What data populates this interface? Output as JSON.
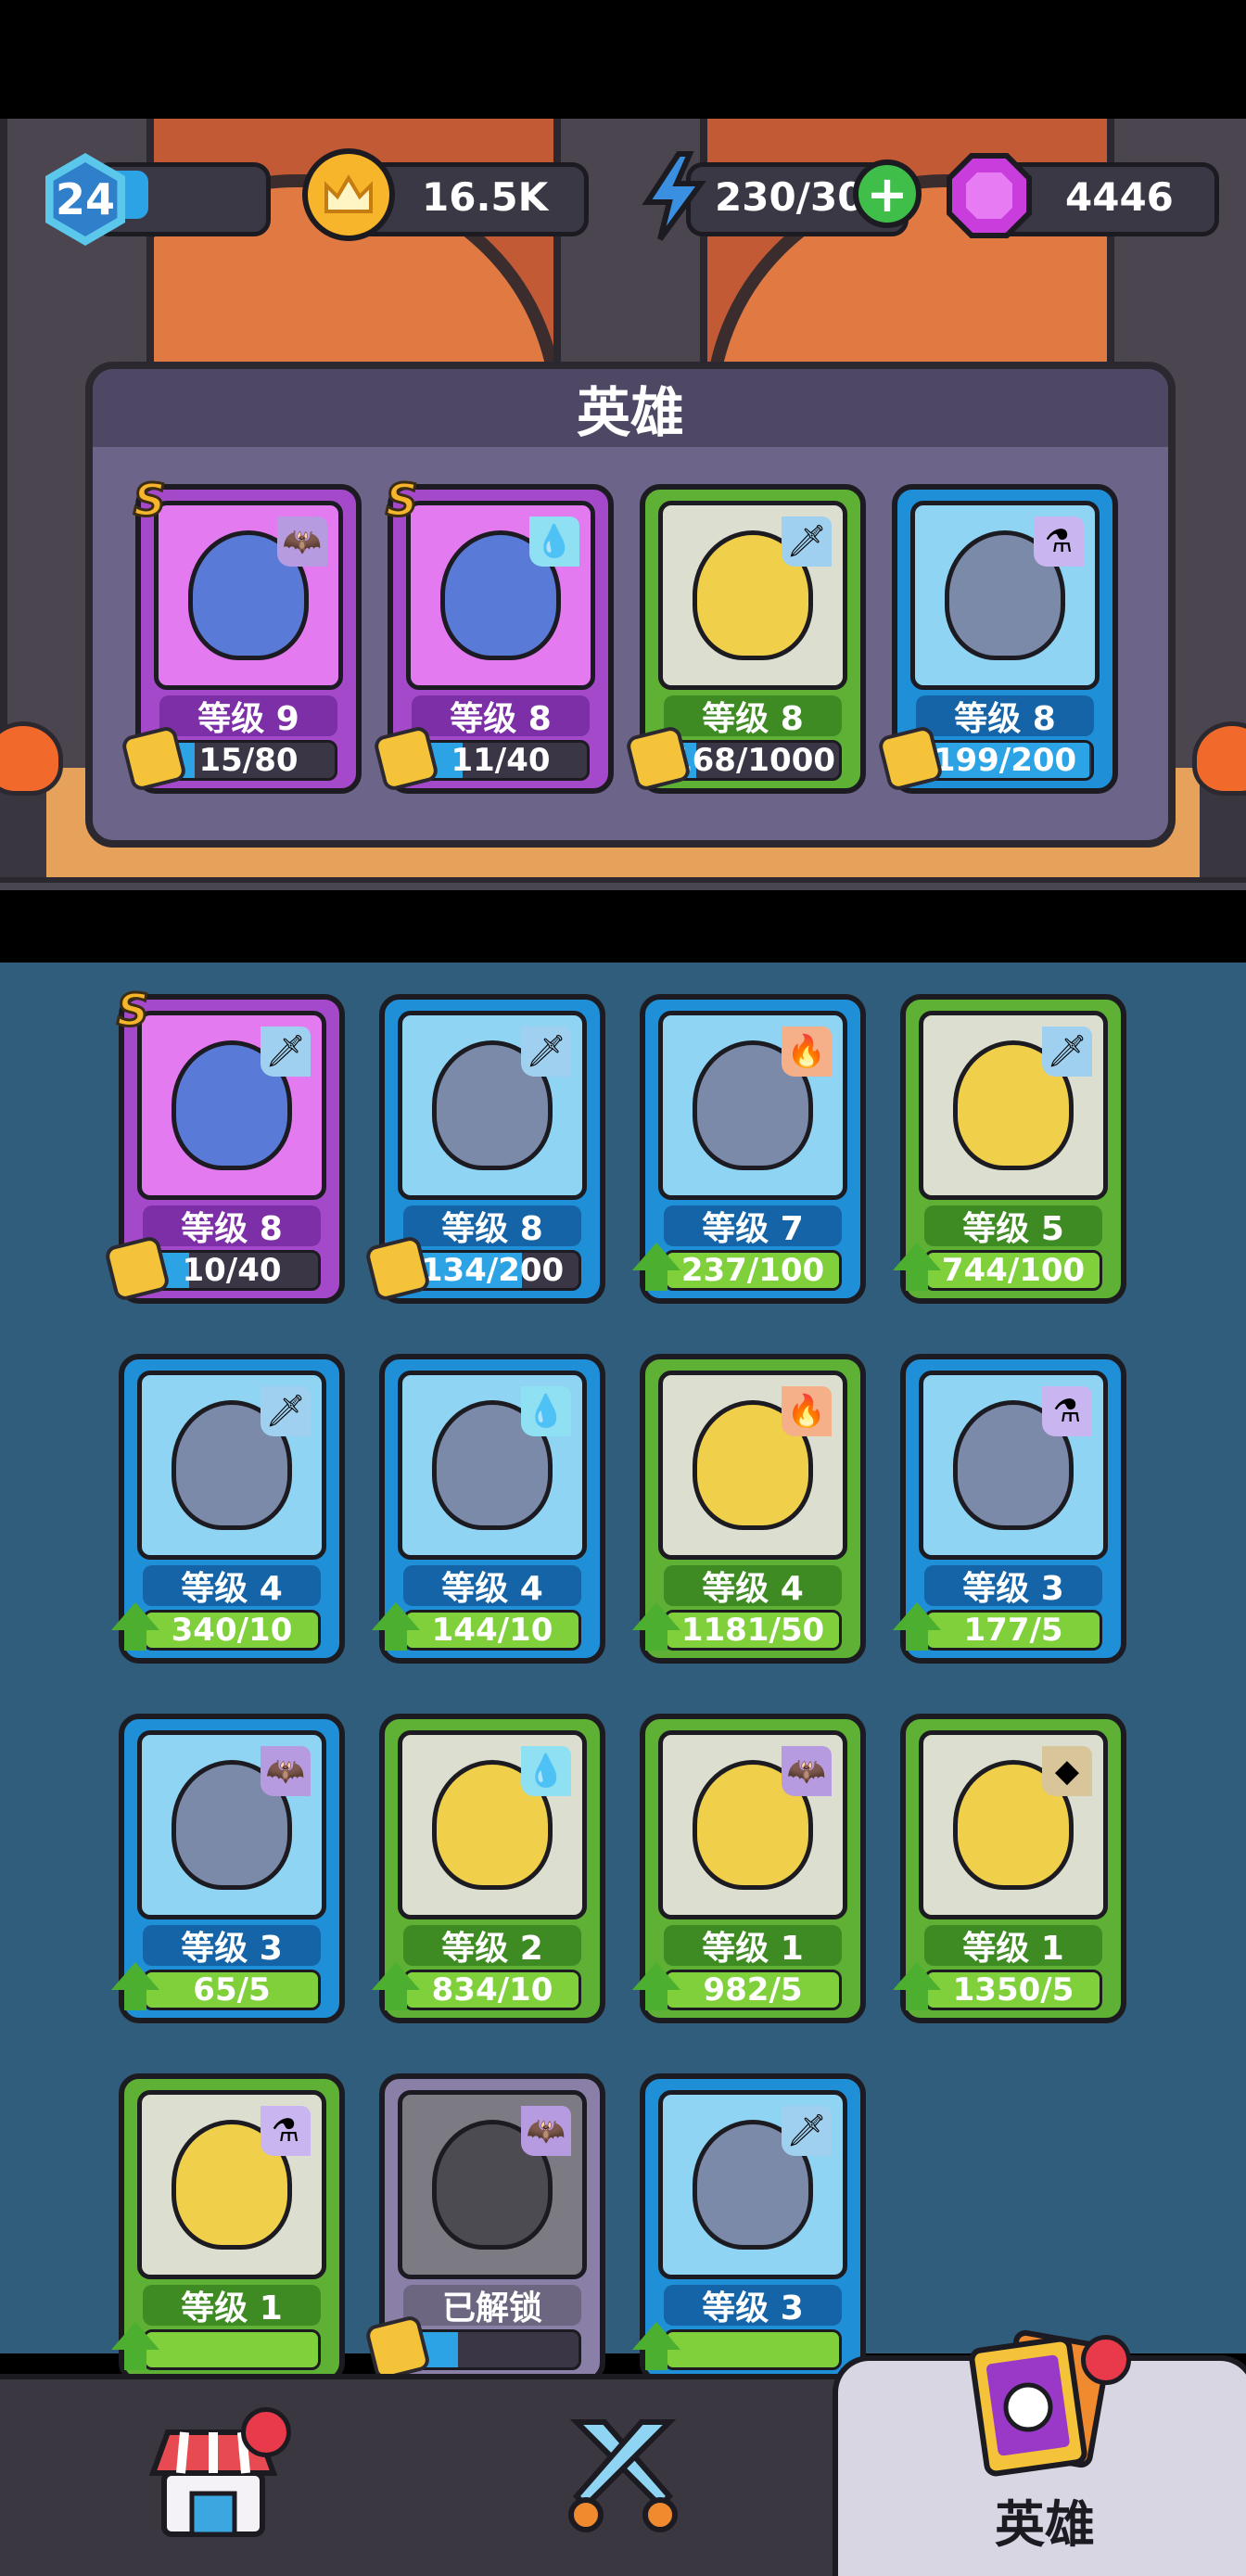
{
  "topbar": {
    "player_level": "24",
    "player_xp_fraction": 0.3,
    "coins": "16.5K",
    "energy": "230/30",
    "gems": "4446"
  },
  "team_panel": {
    "title": "英雄",
    "heroes": [
      {
        "level": "等级 9",
        "progress": "15/80",
        "progress_fraction": 0.19,
        "rarity": "S",
        "element": "bat-icon",
        "color": "purple",
        "progress_kind": "shards"
      },
      {
        "level": "等级 8",
        "progress": "11/40",
        "progress_fraction": 0.28,
        "rarity": "S",
        "element": "water-drop-icon",
        "color": "purple",
        "progress_kind": "shards"
      },
      {
        "level": "等级 8",
        "progress": "168/1000",
        "progress_fraction": 0.17,
        "rarity": "",
        "element": "sword-icon",
        "color": "green",
        "progress_kind": "shards"
      },
      {
        "level": "等级 8",
        "progress": "199/200",
        "progress_fraction": 0.99,
        "rarity": "",
        "element": "potion-icon",
        "color": "blue",
        "progress_kind": "shards"
      }
    ]
  },
  "collection": [
    {
      "level": "等级 8",
      "progress": "10/40",
      "progress_fraction": 0.25,
      "rarity": "S",
      "element": "sword-icon",
      "color": "purple",
      "progress_kind": "shards"
    },
    {
      "level": "等级 8",
      "progress": "134/200",
      "progress_fraction": 0.67,
      "rarity": "",
      "element": "sword-icon",
      "color": "blue",
      "progress_kind": "shards"
    },
    {
      "level": "等级 7",
      "progress": "237/100",
      "progress_fraction": 1,
      "rarity": "",
      "element": "fire-icon",
      "color": "blue",
      "progress_kind": "upgrade"
    },
    {
      "level": "等级 5",
      "progress": "744/100",
      "progress_fraction": 1,
      "rarity": "",
      "element": "sword-icon",
      "color": "green",
      "progress_kind": "upgrade"
    },
    {
      "level": "等级 4",
      "progress": "340/10",
      "progress_fraction": 1,
      "rarity": "",
      "element": "sword-icon",
      "color": "blue",
      "progress_kind": "upgrade"
    },
    {
      "level": "等级 4",
      "progress": "144/10",
      "progress_fraction": 1,
      "rarity": "",
      "element": "water-drop-icon",
      "color": "blue",
      "progress_kind": "upgrade"
    },
    {
      "level": "等级 4",
      "progress": "1181/50",
      "progress_fraction": 1,
      "rarity": "",
      "element": "fire-icon",
      "color": "green",
      "progress_kind": "upgrade"
    },
    {
      "level": "等级 3",
      "progress": "177/5",
      "progress_fraction": 1,
      "rarity": "",
      "element": "potion-icon",
      "color": "blue",
      "progress_kind": "upgrade"
    },
    {
      "level": "等级 3",
      "progress": "65/5",
      "progress_fraction": 1,
      "rarity": "",
      "element": "bat-icon",
      "color": "blue",
      "progress_kind": "upgrade"
    },
    {
      "level": "等级 2",
      "progress": "834/10",
      "progress_fraction": 1,
      "rarity": "",
      "element": "water-drop-icon",
      "color": "green",
      "progress_kind": "upgrade"
    },
    {
      "level": "等级 1",
      "progress": "982/5",
      "progress_fraction": 1,
      "rarity": "",
      "element": "bat-icon",
      "color": "green",
      "progress_kind": "upgrade"
    },
    {
      "level": "等级 1",
      "progress": "1350/5",
      "progress_fraction": 1,
      "rarity": "",
      "element": "rock-icon",
      "color": "green",
      "progress_kind": "upgrade"
    },
    {
      "level": "等级 1",
      "progress": "",
      "progress_fraction": 1,
      "rarity": "",
      "element": "potion-icon",
      "color": "green",
      "progress_kind": "upgrade"
    },
    {
      "level": "已解锁",
      "progress": "",
      "progress_fraction": 0.3,
      "rarity": "",
      "element": "bat-icon",
      "color": "grey",
      "progress_kind": "shards"
    },
    {
      "level": "等级 3",
      "progress": "",
      "progress_fraction": 1,
      "rarity": "",
      "element": "sword-icon",
      "color": "blue",
      "progress_kind": "upgrade"
    }
  ],
  "bottom_nav": {
    "shop_icon": "shop-icon",
    "battle_icon": "crossed-swords-icon",
    "heroes_label": "英雄"
  }
}
